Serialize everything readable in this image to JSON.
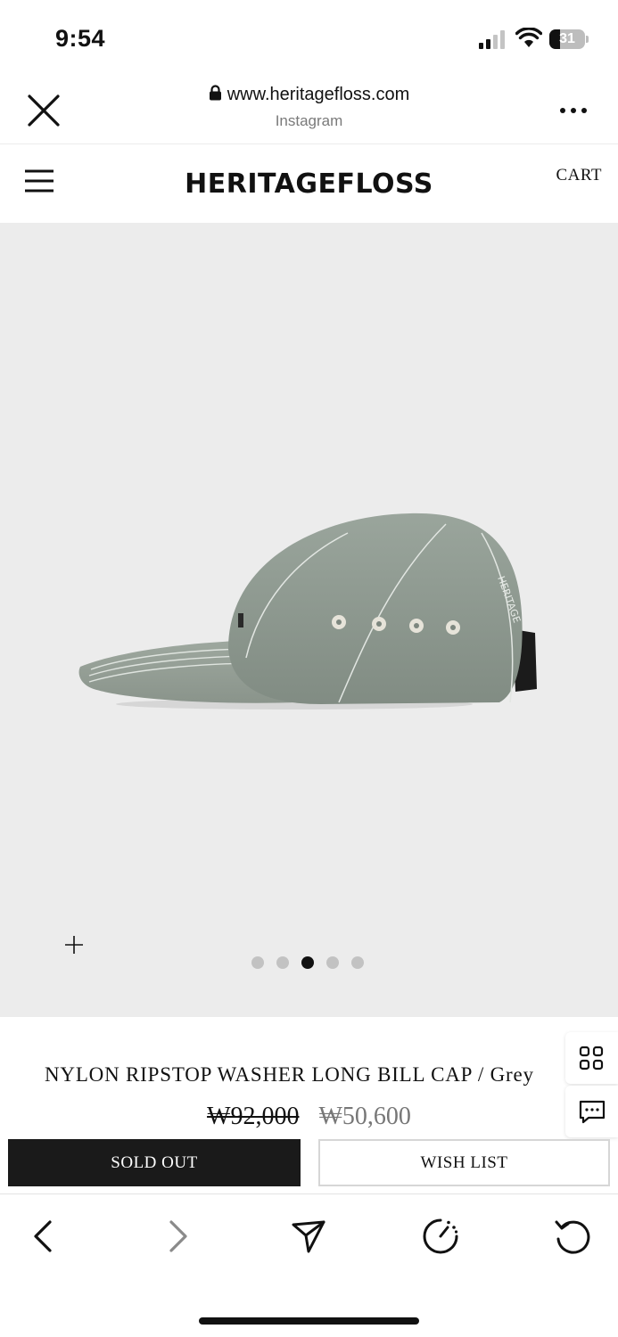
{
  "status_bar": {
    "time": "9:54",
    "battery_level": "31",
    "battery_fraction": 0.31,
    "icons": [
      "signal-icon",
      "wifi-icon",
      "battery-icon"
    ]
  },
  "browser": {
    "url": "www.heritagefloss.com",
    "source": "Instagram",
    "icons": [
      "close-icon",
      "lock-icon",
      "more-icon"
    ]
  },
  "site": {
    "logo": "HERITAGEFLOSS",
    "cart_label": "CART",
    "icons": [
      "hamburger-menu-icon"
    ]
  },
  "product": {
    "name": "NYLON RIPSTOP WASHER LONG BILL CAP / Grey",
    "original_price": "₩92,000",
    "sale_price": "₩50,600",
    "image_count": 5,
    "active_image_index": 2,
    "cap_color": "#8d988f",
    "image_background": "#ececec"
  },
  "actions": {
    "sold_out_label": "SOLD OUT",
    "wishlist_label": "WISH LIST"
  },
  "floating": {
    "icons": [
      "grid-icon",
      "chat-icon"
    ]
  },
  "toolbar": {
    "icons": [
      "back-icon",
      "forward-icon",
      "share-icon",
      "speed-icon",
      "reload-icon"
    ]
  }
}
